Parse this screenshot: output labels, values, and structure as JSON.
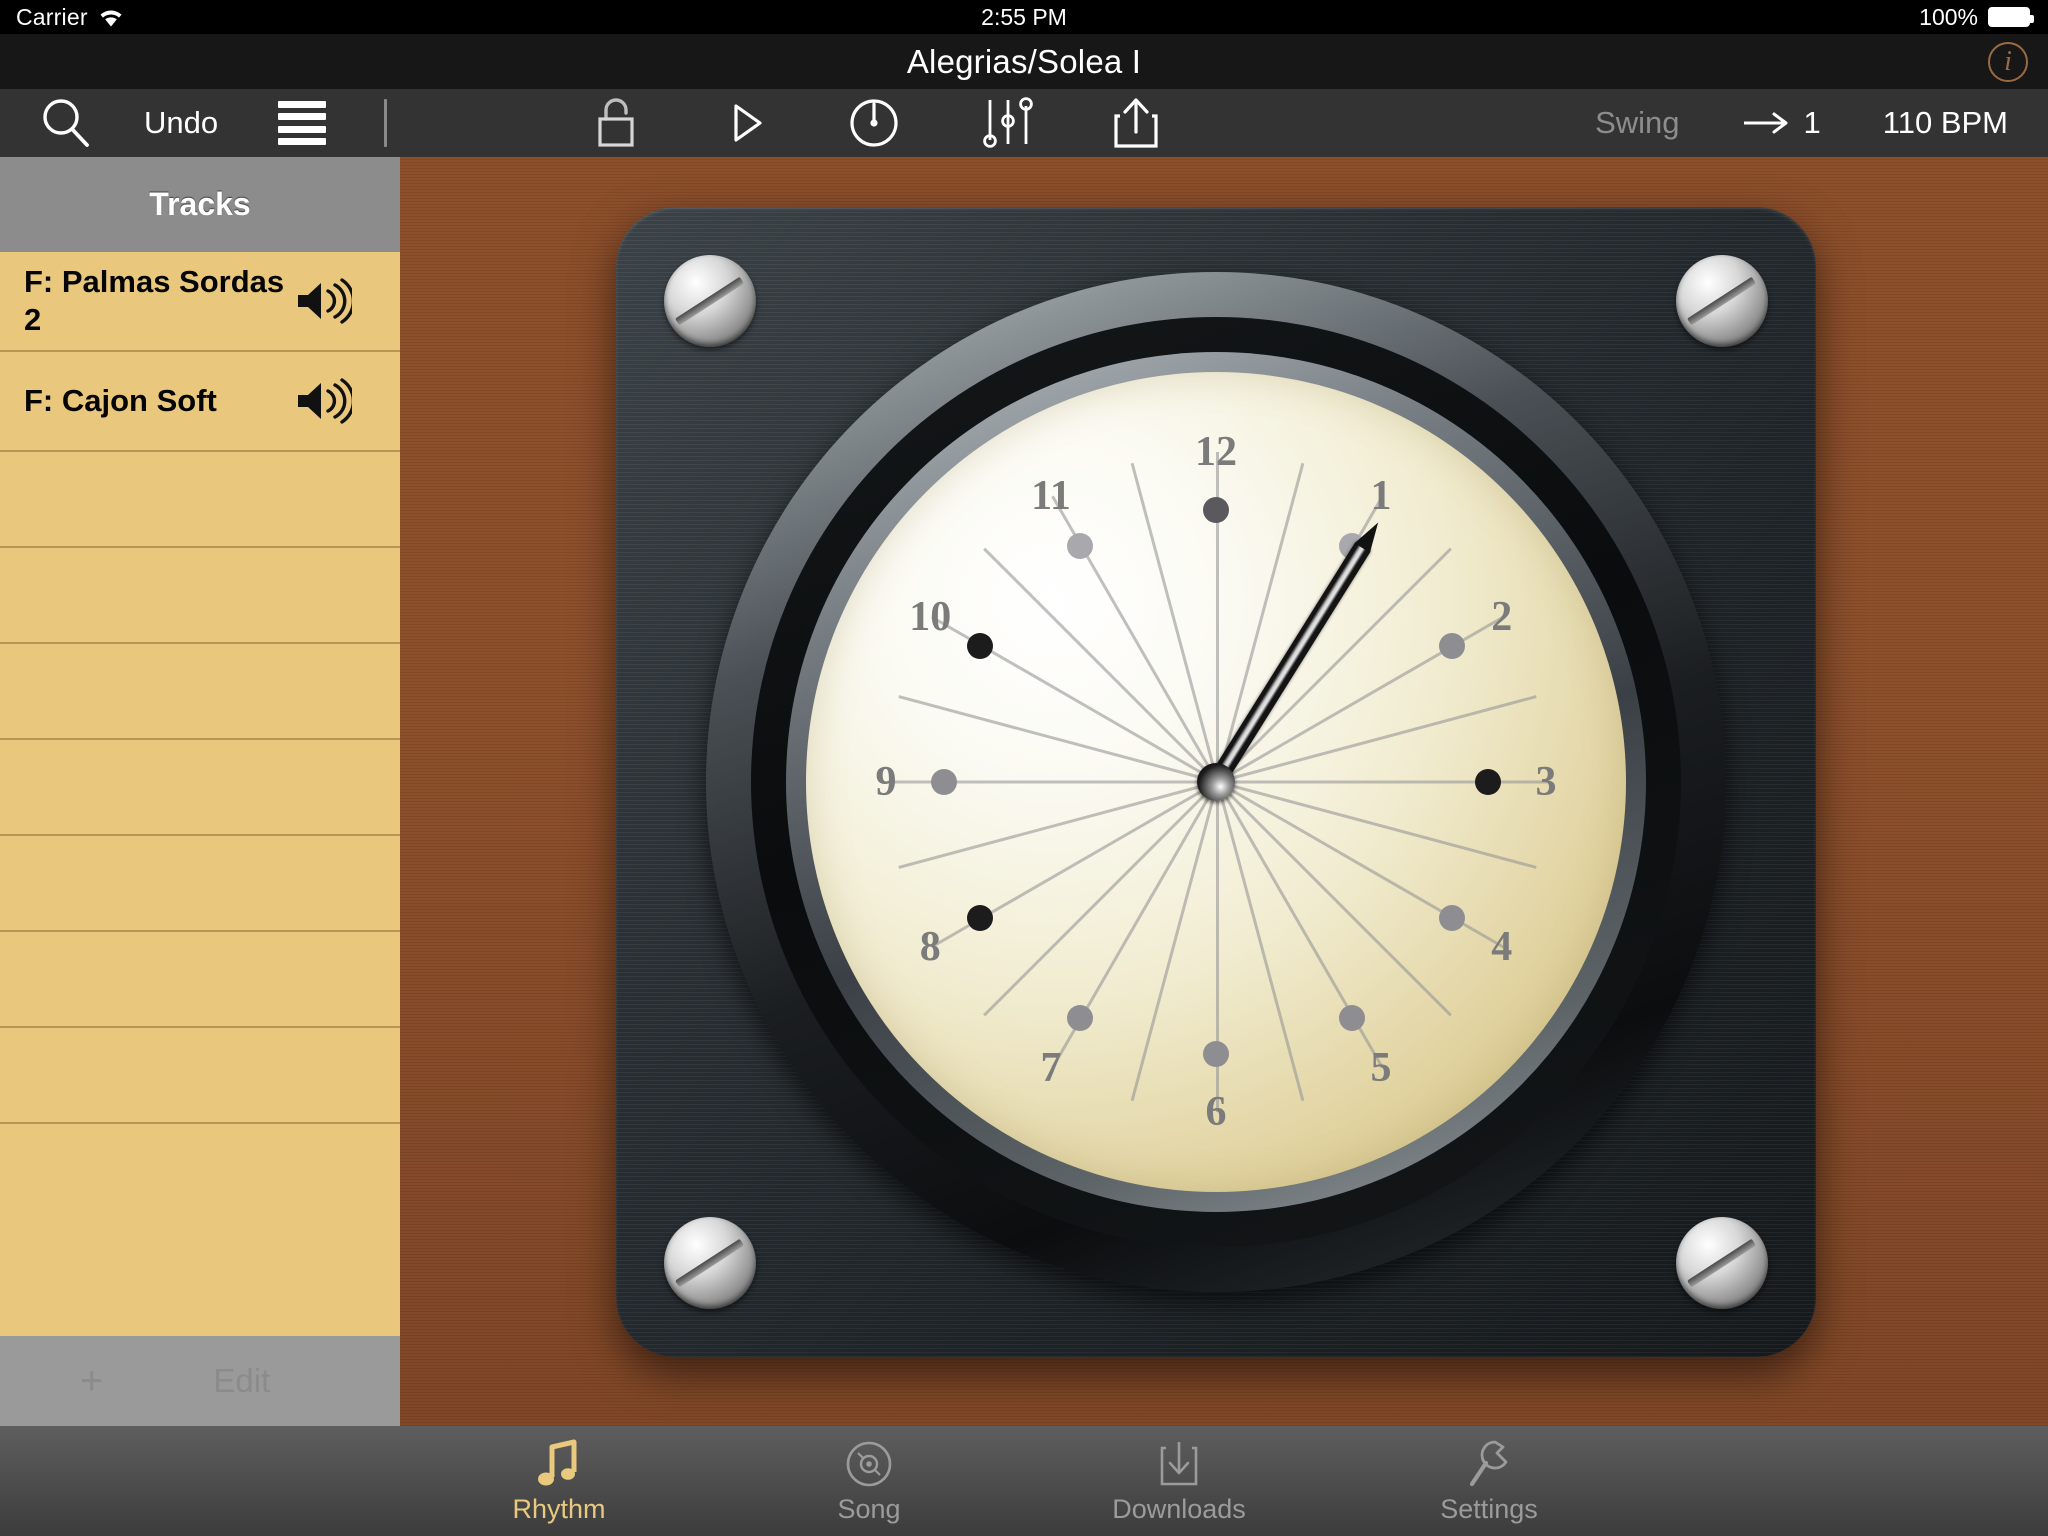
{
  "statusbar": {
    "carrier": "Carrier",
    "wifi_icon": "wifi-icon",
    "time": "2:55 PM",
    "battery_percent": "100%",
    "battery_icon": "battery-full-icon"
  },
  "titlebar": {
    "title": "Alegrias/Solea I",
    "info_label": "i",
    "info_icon": "info-circle-icon"
  },
  "toolbar": {
    "search_icon": "search-icon",
    "undo_label": "Undo",
    "list_icon": "list-lines-icon",
    "lock_icon": "unlock-icon",
    "play_icon": "play-icon",
    "metronome_icon": "metronome-dial-icon",
    "mixer_icon": "mixer-sliders-icon",
    "share_icon": "share-upload-icon",
    "swing_label": "Swing",
    "repeat_label": "1",
    "repeat_icon": "arrow-to-icon",
    "bpm_label": "110 BPM"
  },
  "sidebar": {
    "header": "Tracks",
    "tracks": [
      {
        "name": "F: Palmas Sordas 2",
        "speaker_icon": "speaker-waves-icon"
      },
      {
        "name": "F: Cajon Soft",
        "speaker_icon": "speaker-waves-icon"
      }
    ],
    "empty_row_count": 7,
    "add_label": "+",
    "edit_label": "Edit"
  },
  "metronome": {
    "hand_angle_deg": 32,
    "numerals": [
      "1",
      "2",
      "3",
      "4",
      "5",
      "6",
      "7",
      "8",
      "9",
      "10",
      "11",
      "12"
    ],
    "accents": {
      "1": "#a9a9ad",
      "2": "#8e8e92",
      "3": "#1c1c1c",
      "4": "#8e8e92",
      "5": "#8e8e92",
      "6": "#8e8e92",
      "7": "#8e8e92",
      "8": "#1c1c1c",
      "9": "#8e8e92",
      "10": "#1c1c1c",
      "11": "#a9a9ad",
      "12": "#5a5a5e"
    },
    "screws": [
      "screw-top-left",
      "screw-top-right",
      "screw-bottom-left",
      "screw-bottom-right"
    ]
  },
  "tabbar": {
    "active": "Rhythm",
    "tabs": [
      {
        "label": "Rhythm",
        "icon": "music-note-icon"
      },
      {
        "label": "Song",
        "icon": "disc-icon"
      },
      {
        "label": "Downloads",
        "icon": "download-icon"
      },
      {
        "label": "Settings",
        "icon": "wrench-icon"
      }
    ]
  },
  "colors": {
    "accent_gold": "#e8c97d",
    "sidebar_bg": "#e9c87d",
    "wood_bg": "#8b4d29",
    "toolbar_bg": "#333333"
  }
}
